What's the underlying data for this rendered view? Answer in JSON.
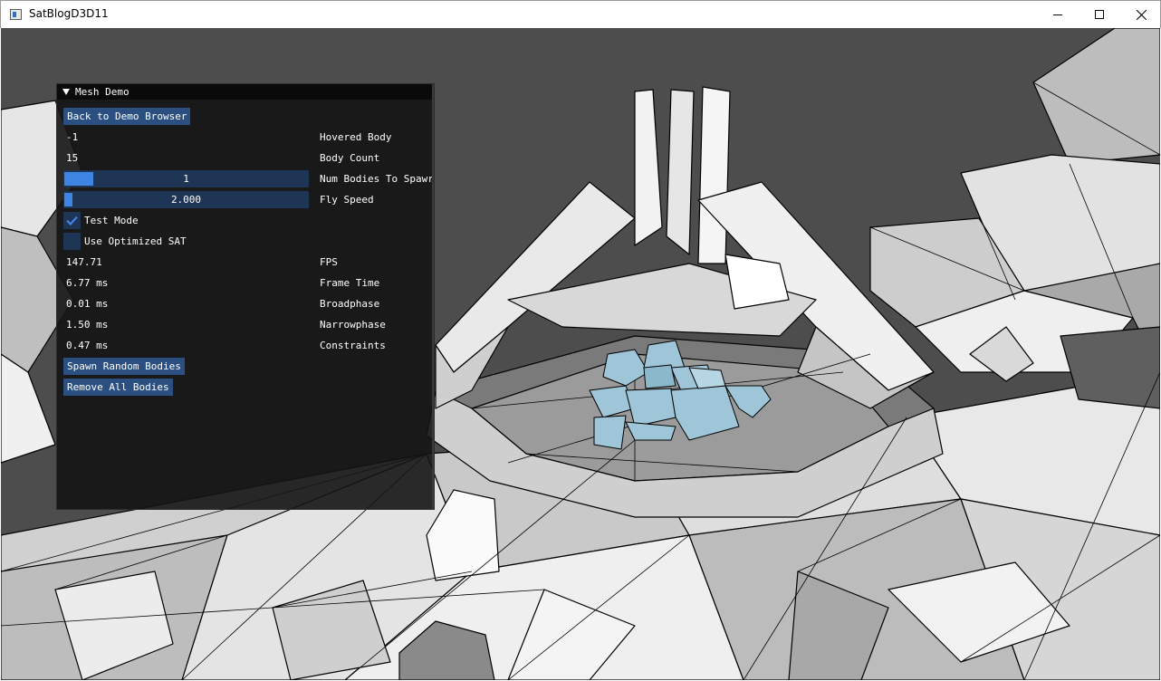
{
  "window": {
    "title": "SatBlogD3D11",
    "icon": "app-window-icon",
    "buttons": [
      "minimize-icon",
      "maximize-icon",
      "close-icon"
    ]
  },
  "panel": {
    "title": "Mesh Demo",
    "back_button": "Back to Demo Browser",
    "hovered_body": {
      "value": "-1",
      "label": "Hovered Body"
    },
    "body_count": {
      "value": "15",
      "label": "Body Count"
    },
    "num_bodies_to_spawn": {
      "value": "1",
      "label": "Num Bodies To Spawr",
      "fill_fraction": 0.12
    },
    "fly_speed": {
      "value": "2.000",
      "label": "Fly Speed",
      "fill_fraction": 0.035
    },
    "test_mode": {
      "label": "Test Mode",
      "checked": true
    },
    "use_optimized_sat": {
      "label": "Use Optimized SAT",
      "checked": false
    },
    "fps": {
      "value": "147.71",
      "label": "FPS"
    },
    "frame_time": {
      "value": "6.77 ms",
      "label": "Frame Time"
    },
    "broadphase": {
      "value": "0.01 ms",
      "label": "Broadphase"
    },
    "narrowphase": {
      "value": "1.50 ms",
      "label": "Narrowphase"
    },
    "constraints": {
      "value": "0.47 ms",
      "label": "Constraints"
    },
    "spawn_button": "Spawn Random Bodies",
    "remove_button": "Remove All Bodies"
  },
  "colors": {
    "accent": "#3d85e0",
    "button": "#2a4f80",
    "frame_bg": "#1e3556",
    "body_fill": "#9ec6d8",
    "mesh_light": "#e8e8e8",
    "mesh_dark": "#9a9a9a"
  }
}
